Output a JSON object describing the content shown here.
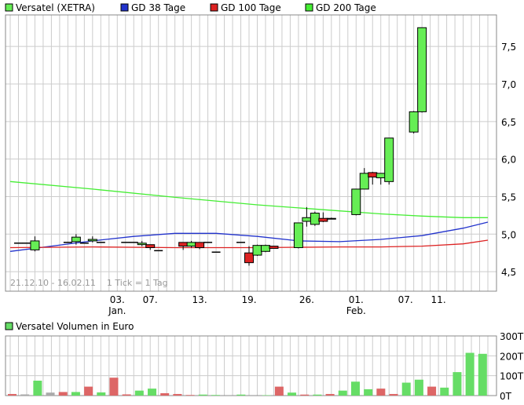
{
  "colors": {
    "up": "#66ee55",
    "down": "#dd2222",
    "gd38": "#2233cc",
    "gd100": "#dd2222",
    "gd200": "#44ee33",
    "grid": "#cccccc",
    "vol_up": "#66dd66",
    "vol_down": "#dd6666",
    "vol_neutral": "#aaaaaa"
  },
  "legend": [
    {
      "label": "Versatel (XETRA)",
      "color": "#66ee55"
    },
    {
      "label": "GD 38 Tage",
      "color": "#2233cc"
    },
    {
      "label": "GD 100 Tage",
      "color": "#dd2222"
    },
    {
      "label": "GD 200 Tage",
      "color": "#44ee33"
    }
  ],
  "info_text": "21.12.10 - 16.02.11    1 Tick = 1 Tag",
  "chart_data": [
    {
      "type": "candlestick",
      "y_ticks": [
        "7,5",
        "7,0",
        "6,5",
        "6,0",
        "5,5",
        "5,0",
        "4,5"
      ],
      "y_tick_values": [
        7.5,
        7.0,
        6.5,
        6.0,
        5.5,
        5.0,
        4.5
      ],
      "ylim": [
        4.24,
        7.92
      ],
      "x_ticks": [
        {
          "label": "03.",
          "day": 13
        },
        {
          "label": "07.",
          "day": 17
        },
        {
          "label": "13.",
          "day": 23
        },
        {
          "label": "19.",
          "day": 29
        },
        {
          "label": "26.",
          "day": 36
        },
        {
          "label": "01.",
          "day": 42
        },
        {
          "label": "07.",
          "day": 48
        },
        {
          "label": "11.",
          "day": 52
        }
      ],
      "month_labels": [
        {
          "label": "Jan.",
          "day": 13
        },
        {
          "label": "Feb.",
          "day": 42
        }
      ],
      "date_range": [
        "21.12.10",
        "16.02.11"
      ],
      "candles": [
        {
          "date": "2010-12-21",
          "open": 4.88,
          "high": 4.88,
          "low": 4.88,
          "close": 4.88
        },
        {
          "date": "2010-12-22",
          "open": 4.88,
          "high": 4.88,
          "low": 4.88,
          "close": 4.88
        },
        {
          "date": "2010-12-23",
          "open": 4.79,
          "high": 4.97,
          "low": 4.77,
          "close": 4.91
        },
        {
          "date": "2010-12-27",
          "open": 4.89,
          "high": 4.89,
          "low": 4.89,
          "close": 4.89
        },
        {
          "date": "2010-12-28",
          "open": 4.9,
          "high": 5.0,
          "low": 4.86,
          "close": 4.96
        },
        {
          "date": "2010-12-29",
          "open": 4.88,
          "high": 4.88,
          "low": 4.88,
          "close": 4.88
        },
        {
          "date": "2010-12-30",
          "open": 4.91,
          "high": 4.97,
          "low": 4.89,
          "close": 4.93
        },
        {
          "date": "2010-12-31",
          "open": 4.89,
          "high": 4.89,
          "low": 4.89,
          "close": 4.89
        },
        {
          "date": "2011-01-03",
          "open": 4.89,
          "high": 4.89,
          "low": 4.89,
          "close": 4.89
        },
        {
          "date": "2011-01-04",
          "open": 4.89,
          "high": 4.89,
          "low": 4.89,
          "close": 4.89
        },
        {
          "date": "2011-01-05",
          "open": 4.86,
          "high": 4.91,
          "low": 4.84,
          "close": 4.88
        },
        {
          "date": "2011-01-06",
          "open": 4.86,
          "high": 4.86,
          "low": 4.79,
          "close": 4.82
        },
        {
          "date": "2011-01-07",
          "open": 4.78,
          "high": 4.78,
          "low": 4.78,
          "close": 4.78
        },
        {
          "date": "2011-01-10",
          "open": 4.89,
          "high": 4.89,
          "low": 4.79,
          "close": 4.84
        },
        {
          "date": "2011-01-11",
          "open": 4.84,
          "high": 4.91,
          "low": 4.82,
          "close": 4.89
        },
        {
          "date": "2011-01-12",
          "open": 4.89,
          "high": 4.89,
          "low": 4.8,
          "close": 4.82
        },
        {
          "date": "2011-01-13",
          "open": 4.89,
          "high": 4.89,
          "low": 4.89,
          "close": 4.89
        },
        {
          "date": "2011-01-14",
          "open": 4.76,
          "high": 4.76,
          "low": 4.76,
          "close": 4.76
        },
        {
          "date": "2011-01-17",
          "open": 4.89,
          "high": 4.89,
          "low": 4.89,
          "close": 4.89
        },
        {
          "date": "2011-01-18",
          "open": 4.75,
          "high": 4.84,
          "low": 4.58,
          "close": 4.62
        },
        {
          "date": "2011-01-19",
          "open": 4.72,
          "high": 4.86,
          "low": 4.71,
          "close": 4.85
        },
        {
          "date": "2011-01-20",
          "open": 4.77,
          "high": 4.86,
          "low": 4.76,
          "close": 4.85
        },
        {
          "date": "2011-01-21",
          "open": 4.84,
          "high": 4.84,
          "low": 4.81,
          "close": 4.81
        },
        {
          "date": "2011-01-24",
          "open": 4.82,
          "high": 5.15,
          "low": 4.81,
          "close": 5.15
        },
        {
          "date": "2011-01-25",
          "open": 5.17,
          "high": 5.36,
          "low": 5.1,
          "close": 5.22
        },
        {
          "date": "2011-01-26",
          "open": 5.13,
          "high": 5.3,
          "low": 5.11,
          "close": 5.28
        },
        {
          "date": "2011-01-27",
          "open": 5.21,
          "high": 5.29,
          "low": 5.16,
          "close": 5.17
        },
        {
          "date": "2011-01-28",
          "open": 5.2,
          "high": 5.22,
          "low": 5.2,
          "close": 5.21
        },
        {
          "date": "2011-01-31",
          "open": 5.26,
          "high": 5.6,
          "low": 5.25,
          "close": 5.6
        },
        {
          "date": "2011-02-01",
          "open": 5.6,
          "high": 5.88,
          "low": 5.6,
          "close": 5.81
        },
        {
          "date": "2011-02-02",
          "open": 5.82,
          "high": 5.83,
          "low": 5.66,
          "close": 5.76
        },
        {
          "date": "2011-02-03",
          "open": 5.75,
          "high": 5.81,
          "low": 5.66,
          "close": 5.81
        },
        {
          "date": "2011-02-04",
          "open": 5.7,
          "high": 6.28,
          "low": 5.66,
          "close": 6.28
        },
        {
          "date": "2011-02-07",
          "open": 6.36,
          "high": 6.64,
          "low": 6.34,
          "close": 6.63
        },
        {
          "date": "2011-02-08",
          "open": 6.63,
          "high": 7.75,
          "low": 6.62,
          "close": 7.75
        }
      ],
      "series": [
        {
          "name": "GD 38 Tage",
          "x": [
            0,
            5,
            10,
            15,
            20,
            25,
            30,
            35,
            40,
            45,
            50,
            55,
            58
          ],
          "y": [
            4.77,
            4.84,
            4.91,
            4.97,
            5.01,
            5.01,
            4.97,
            4.91,
            4.9,
            4.93,
            4.98,
            5.08,
            5.16
          ]
        },
        {
          "name": "GD 100 Tage",
          "x": [
            0,
            10,
            20,
            30,
            40,
            45,
            50,
            55,
            58
          ],
          "y": [
            4.82,
            4.83,
            4.82,
            4.82,
            4.83,
            4.83,
            4.84,
            4.87,
            4.92
          ]
        },
        {
          "name": "GD 200 Tage",
          "x": [
            0,
            10,
            20,
            30,
            40,
            45,
            50,
            55,
            58
          ],
          "y": [
            5.7,
            5.6,
            5.49,
            5.39,
            5.31,
            5.27,
            5.24,
            5.22,
            5.22
          ]
        }
      ]
    },
    {
      "type": "bar",
      "title": "Versatel Volumen in Euro",
      "y_ticks": [
        "300T",
        "200T",
        "100T",
        "0T"
      ],
      "y_tick_values": [
        300,
        200,
        100,
        0
      ],
      "ylim": [
        0,
        300
      ],
      "unit": "T",
      "bars": [
        {
          "x": 0,
          "value": 8,
          "dir": "down"
        },
        {
          "x": 1,
          "value": 6,
          "dir": "neutral"
        },
        {
          "x": 2,
          "value": 75,
          "dir": "up"
        },
        {
          "x": 3,
          "value": 15,
          "dir": "neutral"
        },
        {
          "x": 4,
          "value": 18,
          "dir": "down"
        },
        {
          "x": 5,
          "value": 18,
          "dir": "up"
        },
        {
          "x": 6,
          "value": 45,
          "dir": "down"
        },
        {
          "x": 7,
          "value": 16,
          "dir": "up"
        },
        {
          "x": 8,
          "value": 90,
          "dir": "down"
        },
        {
          "x": 9,
          "value": 6,
          "dir": "down"
        },
        {
          "x": 10,
          "value": 25,
          "dir": "up"
        },
        {
          "x": 11,
          "value": 35,
          "dir": "up"
        },
        {
          "x": 12,
          "value": 12,
          "dir": "down"
        },
        {
          "x": 13,
          "value": 8,
          "dir": "down"
        },
        {
          "x": 14,
          "value": 3,
          "dir": "down"
        },
        {
          "x": 15,
          "value": 5,
          "dir": "up"
        },
        {
          "x": 16,
          "value": 3,
          "dir": "up"
        },
        {
          "x": 18,
          "value": 5,
          "dir": "up"
        },
        {
          "x": 20,
          "value": 2,
          "dir": "up"
        },
        {
          "x": 21,
          "value": 45,
          "dir": "down"
        },
        {
          "x": 22,
          "value": 15,
          "dir": "up"
        },
        {
          "x": 23,
          "value": 5,
          "dir": "down"
        },
        {
          "x": 24,
          "value": 5,
          "dir": "up"
        },
        {
          "x": 25,
          "value": 8,
          "dir": "down"
        },
        {
          "x": 26,
          "value": 25,
          "dir": "up"
        },
        {
          "x": 27,
          "value": 70,
          "dir": "up"
        },
        {
          "x": 28,
          "value": 32,
          "dir": "up"
        },
        {
          "x": 29,
          "value": 35,
          "dir": "down"
        },
        {
          "x": 30,
          "value": 8,
          "dir": "down"
        },
        {
          "x": 31,
          "value": 65,
          "dir": "up"
        },
        {
          "x": 32,
          "value": 80,
          "dir": "up"
        },
        {
          "x": 33,
          "value": 45,
          "dir": "down"
        },
        {
          "x": 34,
          "value": 40,
          "dir": "up"
        },
        {
          "x": 35,
          "value": 118,
          "dir": "up"
        },
        {
          "x": 36,
          "value": 215,
          "dir": "up"
        },
        {
          "x": 37,
          "value": 210,
          "dir": "up"
        }
      ]
    }
  ]
}
